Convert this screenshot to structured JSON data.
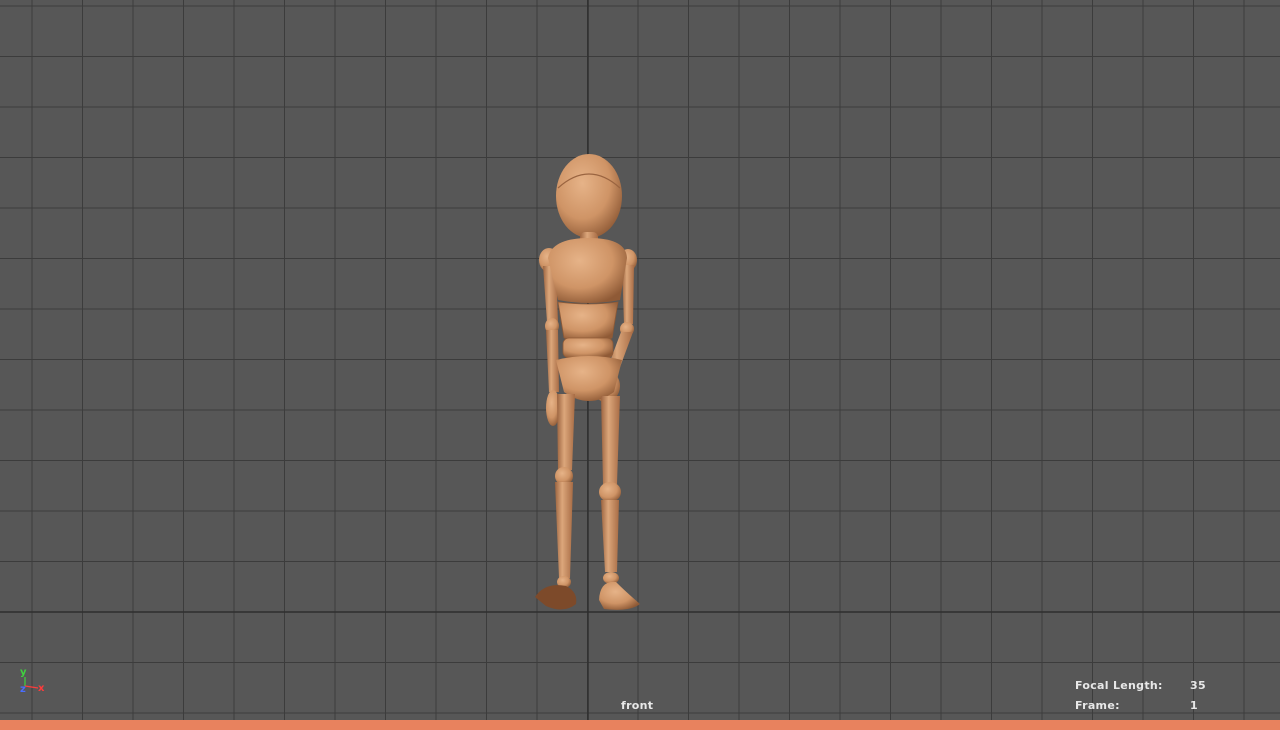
{
  "viewport": {
    "camera_name": "front",
    "background_color": "#575757",
    "grid_color": "#3c3c3c",
    "ground_line_color": "#2e2e2e",
    "model_color": "#d39a6c",
    "model_shadow_color": "#7a4a2c"
  },
  "hud": {
    "focal_length_label": "Focal Length:",
    "focal_length_value": "35",
    "frame_label": "Frame:",
    "frame_value": "1"
  },
  "axis_gizmo": {
    "y_label": "y",
    "z_label": "z",
    "x_label": "x",
    "y_color": "#3fd33f",
    "z_color": "#4a6dff",
    "x_color": "#ff3b3b"
  },
  "timeline": {
    "strip_color": "#e8825e"
  }
}
